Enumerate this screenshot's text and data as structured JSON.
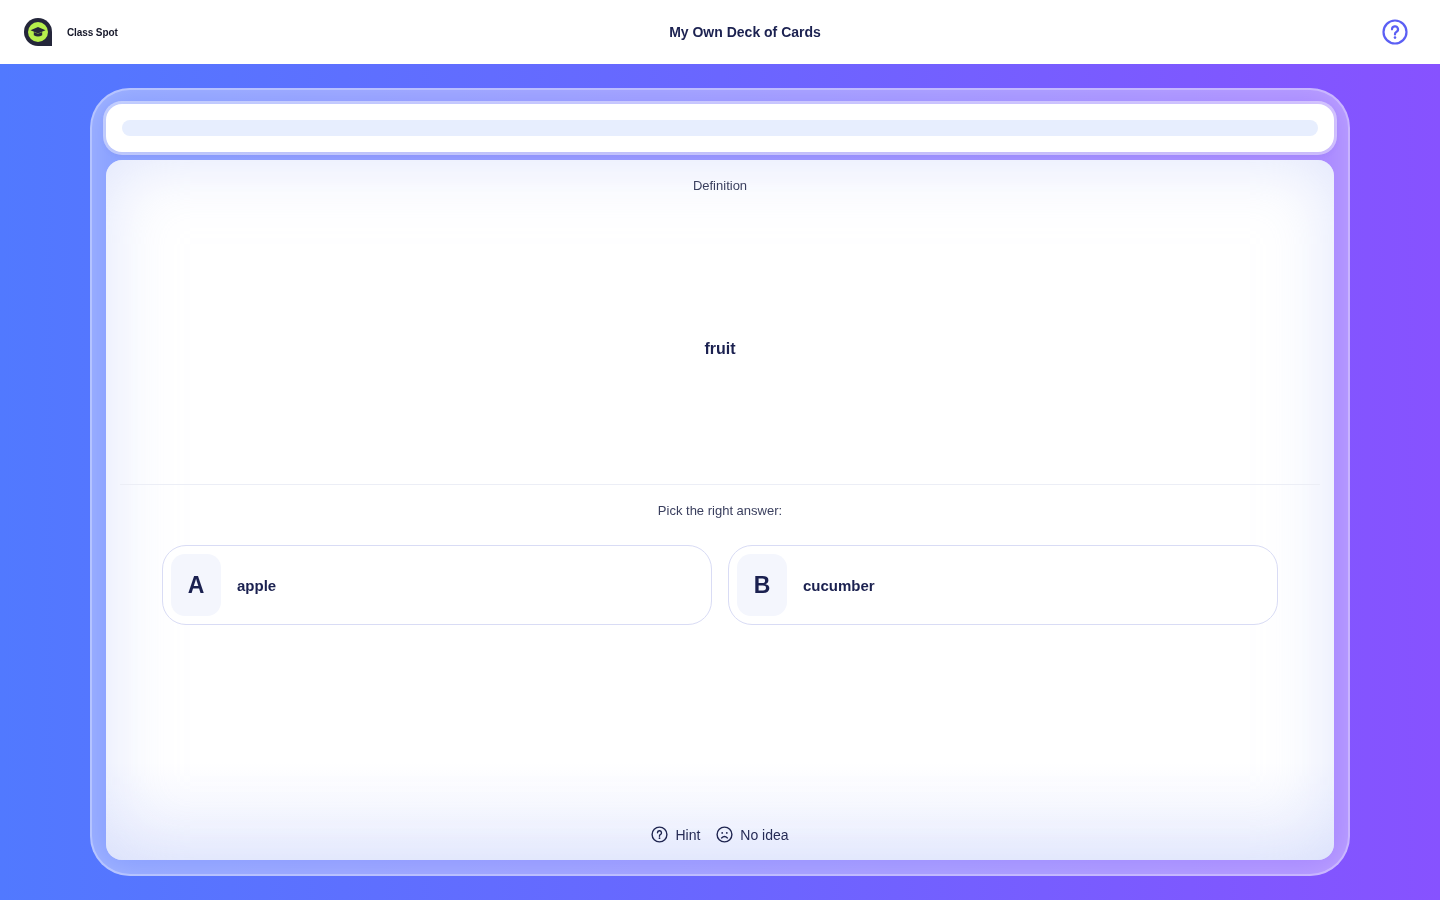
{
  "header": {
    "brand": "Class Spot",
    "title": "My Own Deck of Cards"
  },
  "progress": {
    "level": 0
  },
  "card": {
    "prompt_label": "Definition",
    "prompt": "fruit",
    "instruction": "Pick the right answer:",
    "options": [
      {
        "letter": "A",
        "text": "apple",
        "selected": false
      },
      {
        "letter": "B",
        "text": "cucumber",
        "selected": false
      }
    ],
    "actions": [
      {
        "kind": "hint",
        "label": "Hint"
      },
      {
        "kind": "give-up",
        "label": "No idea"
      }
    ]
  }
}
